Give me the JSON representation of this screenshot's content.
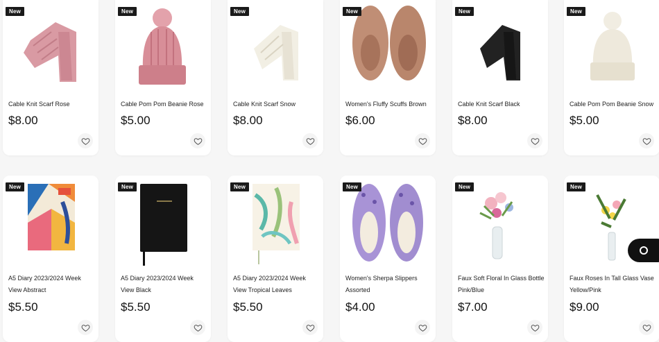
{
  "badge_label": "New",
  "products": [
    {
      "name": "Cable Knit Scarf Rose",
      "price": "$8.00",
      "image_icon": "pink-scarf-image"
    },
    {
      "name": "Cable Pom Pom Beanie Rose",
      "price": "$5.00",
      "image_icon": "pink-beanie-image"
    },
    {
      "name": "Cable Knit Scarf Snow",
      "price": "$8.00",
      "image_icon": "white-scarf-image"
    },
    {
      "name": "Women's Fluffy Scuffs Brown",
      "price": "$6.00",
      "image_icon": "brown-slippers-image"
    },
    {
      "name": "Cable Knit Scarf Black",
      "price": "$8.00",
      "image_icon": "black-scarf-image"
    },
    {
      "name": "Cable Pom Pom Beanie Snow",
      "price": "$5.00",
      "image_icon": "white-beanie-image"
    },
    {
      "name": "A5 Diary 2023/2024 Week View Abstract",
      "price": "$5.50",
      "image_icon": "abstract-diary-image"
    },
    {
      "name": "A5 Diary 2023/2024 Week View Black",
      "price": "$5.50",
      "image_icon": "black-diary-image"
    },
    {
      "name": "A5 Diary 2023/2024 Week View Tropical Leaves",
      "price": "$5.50",
      "image_icon": "tropical-diary-image"
    },
    {
      "name": "Women's Sherpa Slippers Assorted",
      "price": "$4.00",
      "image_icon": "purple-slippers-image"
    },
    {
      "name": "Faux Soft Floral In Glass Bottle Pink/Blue",
      "price": "$7.00",
      "image_icon": "floral-bottle-image"
    },
    {
      "name": "Faux Roses In Tall Glass Vase Yellow/Pink",
      "price": "$9.00",
      "image_icon": "roses-vase-image"
    }
  ],
  "colors": {
    "badge": "#1a1a1a",
    "background": "#f6f6f6",
    "card": "#ffffff",
    "chat_button": "#111111"
  }
}
